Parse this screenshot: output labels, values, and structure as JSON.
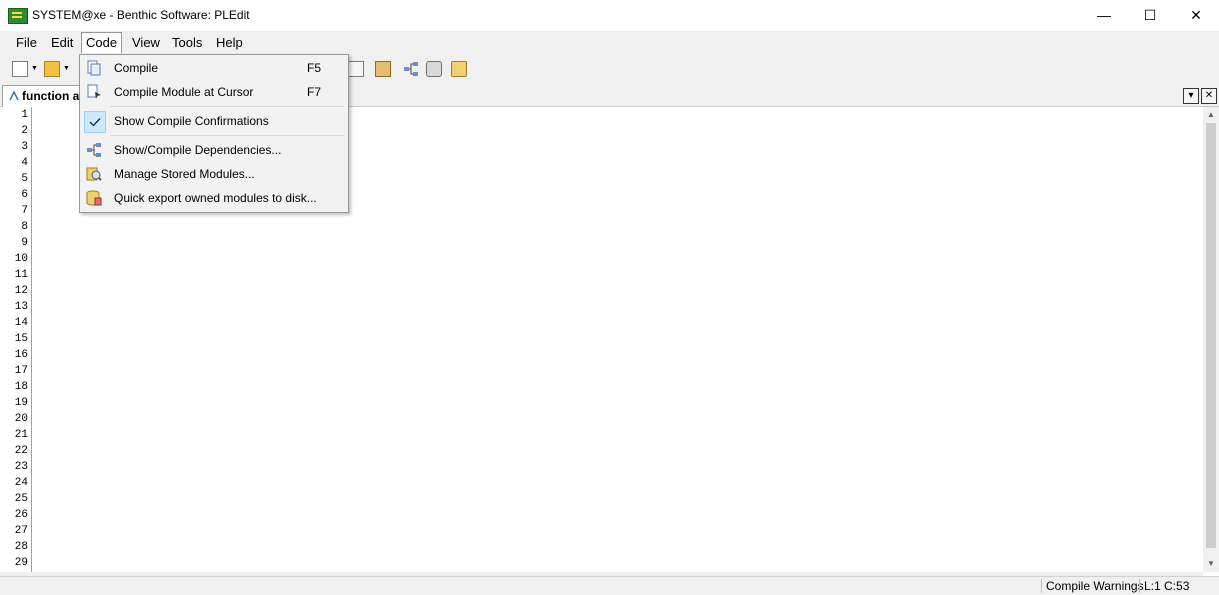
{
  "window": {
    "title": "SYSTEM@xe - Benthic Software: PLEdit",
    "minimize": "—",
    "maximize": "☐",
    "close": "✕"
  },
  "menubar": {
    "file": "File",
    "edit": "Edit",
    "code": "Code",
    "view": "View",
    "tools": "Tools",
    "help": "Help"
  },
  "tab": {
    "label": "function ap",
    "dropdown_glyph": "▾",
    "close_glyph": "✕"
  },
  "code_menu": {
    "items": [
      {
        "label": "Compile",
        "shortcut": "F5",
        "icon": "compile-icon"
      },
      {
        "label": "Compile Module at Cursor",
        "shortcut": "F7",
        "icon": "compile-cursor-icon"
      },
      {
        "label": "Show Compile Confirmations",
        "shortcut": "",
        "icon": "check-icon",
        "checked": true
      },
      {
        "label": "Show/Compile Dependencies...",
        "shortcut": "",
        "icon": "dependency-tree-icon"
      },
      {
        "label": "Manage Stored Modules...",
        "shortcut": "",
        "icon": "stored-modules-icon"
      },
      {
        "label": "Quick export owned modules to disk...",
        "shortcut": "",
        "icon": "export-disk-icon"
      }
    ]
  },
  "editor": {
    "line_numbers": [
      "1",
      "2",
      "3",
      "4",
      "5",
      "6",
      "7",
      "8",
      "9",
      "10",
      "11",
      "12",
      "13",
      "14",
      "15",
      "16",
      "17",
      "18",
      "19",
      "20",
      "21",
      "22",
      "23",
      "24",
      "25",
      "26",
      "27",
      "28",
      "29"
    ]
  },
  "status": {
    "compile_warnings": "Compile Warnings",
    "cursor_position": "L:1 C:53"
  },
  "colors": {
    "keyword": "#800080",
    "string": "#0000ff",
    "bracket_highlight": "#00ffff"
  }
}
